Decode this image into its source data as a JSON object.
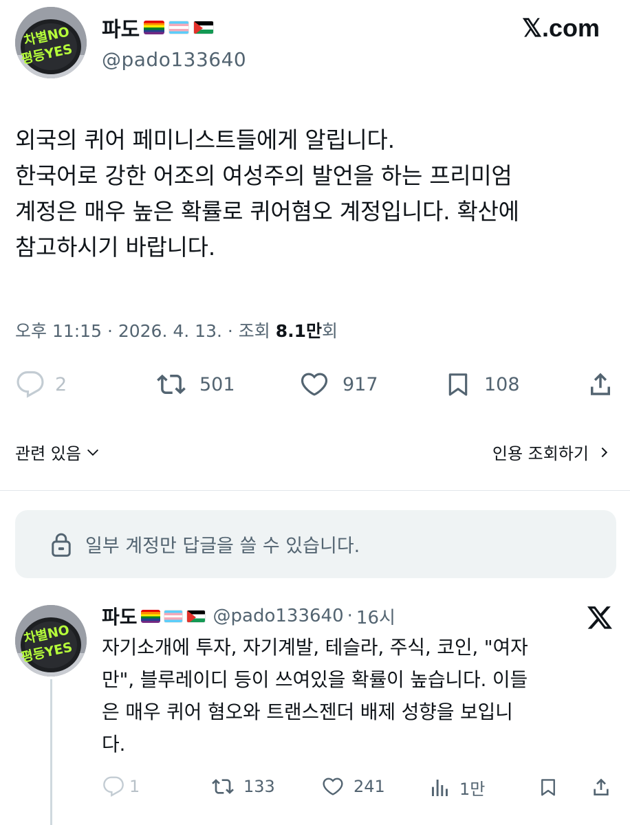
{
  "brand": {
    "logo_text": "𝕏.com"
  },
  "tweet": {
    "author": {
      "name": "파도",
      "flags": [
        "rainbow-flag",
        "trans-flag",
        "palestine-flag"
      ],
      "handle": "@pado133640",
      "avatar_sign_line1": "차별NO",
      "avatar_sign_line2": "평등YES"
    },
    "text_lines": [
      "외국의 퀴어 페미니스트들에게 알립니다.",
      "한국어로 강한 어조의 여성주의 발언을 하는 프리미엄",
      "계정은 매우 높은 확률로 퀴어혐오 계정입니다. 확산에",
      "참고하시기 바랍니다."
    ],
    "meta": {
      "time": "오후 11:15",
      "sep1": " · ",
      "date": "2026. 4. 13.",
      "sep2": " · ",
      "views_label": "조회 ",
      "views_count": "8.1만",
      "views_suffix": "회"
    },
    "actions": {
      "replies": "2",
      "retweets": "501",
      "likes": "917",
      "bookmarks": "108"
    },
    "related": {
      "left_label": "관련 있음",
      "right_label": "인용 조회하기"
    },
    "reply_restriction": "일부 계정만 답글을 쓸 수 있습니다."
  },
  "reply": {
    "author": {
      "name": "파도",
      "handle": "@pado133640",
      "dot": "·",
      "time": "16시"
    },
    "text_lines": [
      "자기소개에 투자, 자기계발, 테슬라, 주식, 코인, \"여자",
      "만\", 블루레이디 등이 쓰여있을 확률이 높습니다. 이들",
      "은 매우 퀴어 혐오와 트랜스젠더 배제 성향을 보입니",
      "다."
    ],
    "actions": {
      "replies": "1",
      "retweets": "133",
      "likes": "241",
      "views": "1만"
    }
  },
  "colors": {
    "text": "#0f1419",
    "muted": "#536471",
    "divider": "#e1e6ea",
    "reply_box_bg": "#eff3f4"
  }
}
